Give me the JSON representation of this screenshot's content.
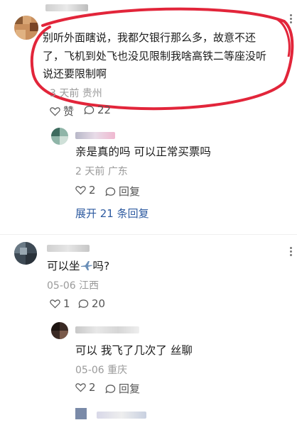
{
  "comments": [
    {
      "text_line1": "别听外面瞎说，我都欠银行那么多，故意不还",
      "text_line2": "了，飞机到处飞也没见限制我啥高铁二等座没听",
      "text_line3": "说还要限制啊",
      "date": "3 天前",
      "location": "贵州",
      "like_label": "赞",
      "reply_count": "22"
    },
    {
      "text": "亲是真的吗 可以正常买票吗",
      "date": "2 天前",
      "location": "广东",
      "like_count": "2",
      "reply_label": "回复",
      "expand_label": "展开 21 条回复"
    },
    {
      "text_before": "可以坐",
      "text_after": "吗?",
      "emoji": "airplane-emoji",
      "date": "05-06",
      "location": "江西",
      "like_count": "1",
      "reply_count": "20"
    },
    {
      "text": "可以 我飞了几次了 丝聊",
      "date": "05-06",
      "location": "重庆",
      "like_count": "2",
      "reply_label": "回复"
    }
  ],
  "colors": {
    "highlight": "#e2253a",
    "link": "#2d5aa0",
    "meta": "#9a9a9a"
  },
  "icons": [
    "heart-icon",
    "comment-icon",
    "more-icon"
  ]
}
